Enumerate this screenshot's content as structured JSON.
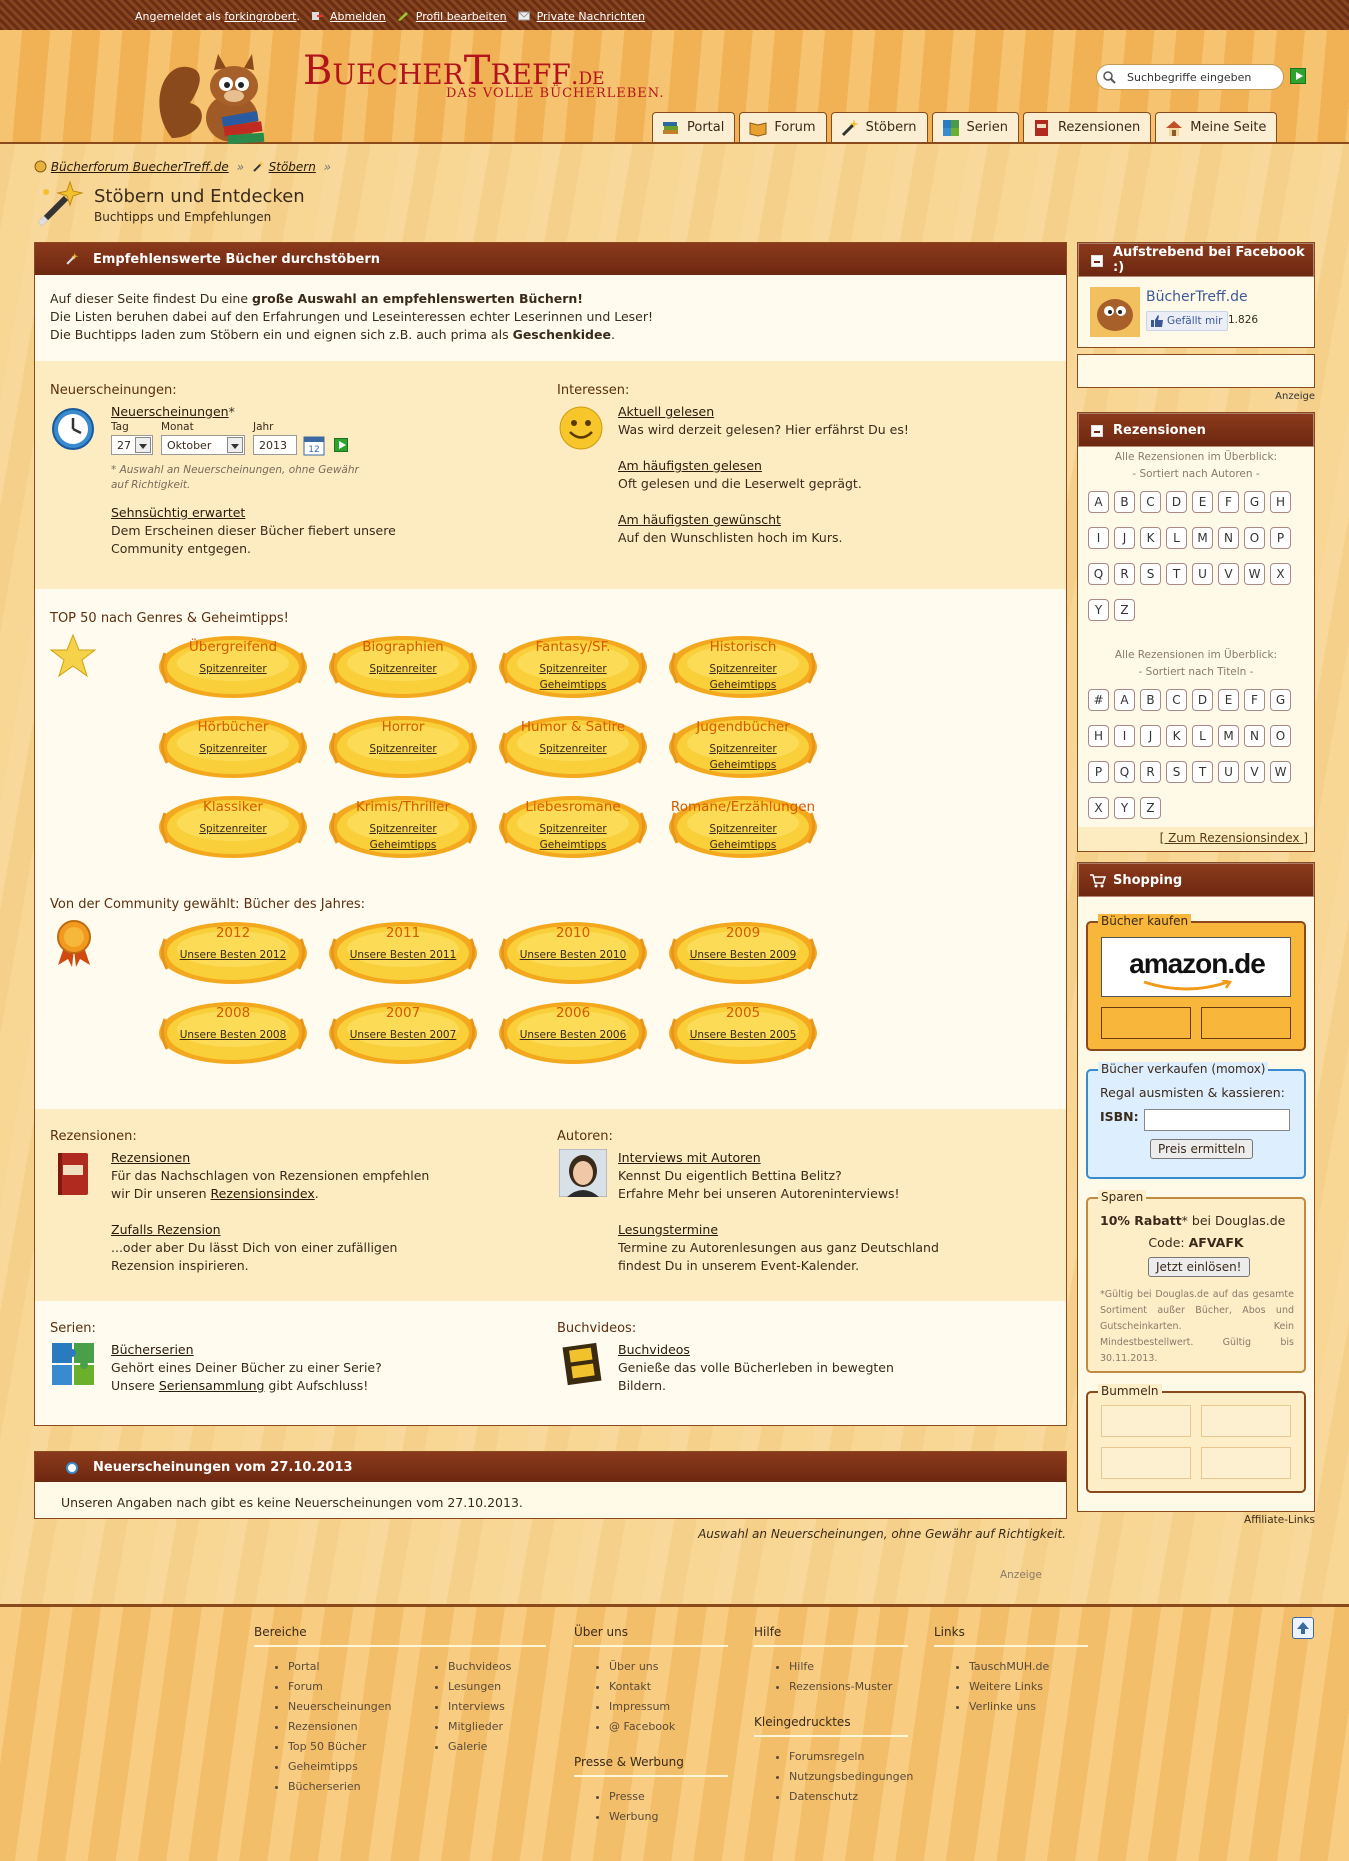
{
  "topbar": {
    "logged_in_prefix": "Angemeldet als",
    "username": "forkingrobert",
    "logout": "Abmelden",
    "edit_profile": "Profil bearbeiten",
    "messages": "Private Nachrichten"
  },
  "logo": {
    "title": "BuecherTreff",
    "tld": ".de",
    "tagline": "DAS VOLLE BÜCHERLEBEN."
  },
  "search": {
    "placeholder": "Suchbegriffe eingeben"
  },
  "nav": [
    "Portal",
    "Forum",
    "Stöbern",
    "Serien",
    "Rezensionen",
    "Meine Seite"
  ],
  "breadcrumb": {
    "home": "Bücherforum BuecherTreff.de",
    "current": "Stöbern",
    "sep": "»"
  },
  "page": {
    "title": "Stöbern und Entdecken",
    "subtitle": "Buchtipps und Empfehlungen"
  },
  "main": {
    "header": "Empfehlenswerte Bücher durchstöbern",
    "intro1_pre": "Auf dieser Seite findest Du eine ",
    "intro1_bold": "große Auswahl an empfehlenswerten Büchern!",
    "intro2": "Die Listen beruhen dabei auf den Erfahrungen und Leseinteressen echter Leserinnen und Leser!",
    "intro3_pre": "Die Buchtipps laden zum Stöbern ein und eignen sich z.B. auch prima als ",
    "intro3_bold": "Geschenkidee",
    "intro3_end": "."
  },
  "new_releases": {
    "heading": "Neuerscheinungen:",
    "link": "Neuerscheinungen",
    "star": "*",
    "day_label": "Tag",
    "month_label": "Monat",
    "year_label": "Jahr",
    "day": "27",
    "month": "Oktober",
    "year": "2013",
    "note": "* Auswahl an Neuerscheinungen, ohne Gewähr auf Richtigkeit.",
    "awaited_link": "Sehnsüchtig erwartet",
    "awaited_text1": "Dem Erscheinen dieser Bücher fiebert unsere",
    "awaited_text2": "Community entgegen."
  },
  "interests": {
    "heading": "Interessen:",
    "items": [
      {
        "link": "Aktuell gelesen",
        "text": "Was wird derzeit gelesen? Hier erfährst Du es!"
      },
      {
        "link": "Am häufigsten gelesen",
        "text": "Oft gelesen und die Leserwelt geprägt."
      },
      {
        "link": "Am häufigsten gewünscht",
        "text": "Auf den Wunschlisten hoch im Kurs."
      }
    ]
  },
  "top50": {
    "heading": "TOP 50 nach Genres & Geheimtipps!",
    "badges": [
      {
        "title": "Übergreifend",
        "l1": "Spitzenreiter",
        "l2": ""
      },
      {
        "title": "Biographien",
        "l1": "Spitzenreiter",
        "l2": ""
      },
      {
        "title": "Fantasy/SF.",
        "l1": "Spitzenreiter",
        "l2": "Geheimtipps"
      },
      {
        "title": "Historisch",
        "l1": "Spitzenreiter",
        "l2": "Geheimtipps"
      },
      {
        "title": "Hörbücher",
        "l1": "Spitzenreiter",
        "l2": ""
      },
      {
        "title": "Horror",
        "l1": "Spitzenreiter",
        "l2": ""
      },
      {
        "title": "Humor & Satire",
        "l1": "Spitzenreiter",
        "l2": ""
      },
      {
        "title": "Jugendbücher",
        "l1": "Spitzenreiter",
        "l2": "Geheimtipps"
      },
      {
        "title": "Klassiker",
        "l1": "Spitzenreiter",
        "l2": ""
      },
      {
        "title": "Krimis/Thriller",
        "l1": "Spitzenreiter",
        "l2": "Geheimtipps"
      },
      {
        "title": "Liebesromane",
        "l1": "Spitzenreiter",
        "l2": "Geheimtipps"
      },
      {
        "title": "Romane/Erzählungen",
        "l1": "Spitzenreiter",
        "l2": "Geheimtipps"
      }
    ]
  },
  "years": {
    "heading": "Von der Community gewählt: Bücher des Jahres:",
    "badges": [
      {
        "title": "2012",
        "l1": "Unsere Besten 2012"
      },
      {
        "title": "2011",
        "l1": "Unsere Besten 2011"
      },
      {
        "title": "2010",
        "l1": "Unsere Besten 2010"
      },
      {
        "title": "2009",
        "l1": "Unsere Besten 2009"
      },
      {
        "title": "2008",
        "l1": "Unsere Besten 2008"
      },
      {
        "title": "2007",
        "l1": "Unsere Besten 2007"
      },
      {
        "title": "2006",
        "l1": "Unsere Besten 2006"
      },
      {
        "title": "2005",
        "l1": "Unsere Besten 2005"
      }
    ]
  },
  "reviews": {
    "heading": "Rezensionen:",
    "link": "Rezensionen",
    "text1": "Für das Nachschlagen von Rezensionen empfehlen",
    "text2_pre": "wir Dir unseren ",
    "text2_link": "Rezensionsindex",
    "text2_end": ".",
    "random_link": "Zufalls Rezension",
    "random_text1": "...oder aber Du lässt Dich von einer zufälligen",
    "random_text2": "Rezension inspirieren."
  },
  "authors": {
    "heading": "Autoren:",
    "link": "Interviews mit Autoren",
    "text1": "Kennst Du eigentlich Bettina Belitz?",
    "text2": "Erfahre Mehr bei unseren Autoreninterviews!",
    "readings_link": "Lesungstermine",
    "readings_text1": "Termine zu Autorenlesungen aus ganz Deutschland",
    "readings_text2": "findest Du in unserem Event-Kalender."
  },
  "series": {
    "heading": "Serien:",
    "link": "Bücherserien",
    "text1": "Gehört eines Deiner Bücher zu einer Serie?",
    "text2_pre": "Unsere ",
    "text2_link": "Seriensammlung",
    "text2_end": " gibt Aufschluss!"
  },
  "videos": {
    "heading": "Buchvideos:",
    "link": "Buchvideos",
    "text1": "Genieße das volle Bücherleben in bewegten",
    "text2": "Bildern."
  },
  "new_box": {
    "header": "Neuerscheinungen vom 27.10.2013",
    "text": "Unseren Angaben nach gibt es keine Neuerscheinungen vom 27.10.2013.",
    "note": "Auswahl an Neuerscheinungen, ohne Gewähr auf Richtigkeit.",
    "ad": "Anzeige"
  },
  "sidebar": {
    "facebook": {
      "header": "Aufstrebend bei Facebook :)",
      "name": "BücherTreff.de",
      "like": "Gefällt mir",
      "count": "1.826"
    },
    "ad_label": "Anzeige",
    "reviews": {
      "header": "Rezensionen",
      "by_author_1": "Alle Rezensionen im Überblick:",
      "by_author_2": "- Sortiert nach Autoren -",
      "author_letters": [
        "A",
        "B",
        "C",
        "D",
        "E",
        "F",
        "G",
        "H",
        "I",
        "J",
        "K",
        "L",
        "M",
        "N",
        "O",
        "P",
        "Q",
        "R",
        "S",
        "T",
        "U",
        "V",
        "W",
        "X",
        "Y",
        "Z"
      ],
      "by_title_1": "Alle Rezensionen im Überblick:",
      "by_title_2": "- Sortiert nach Titeln -",
      "title_letters": [
        "#",
        "A",
        "B",
        "C",
        "D",
        "E",
        "F",
        "G",
        "H",
        "I",
        "J",
        "K",
        "L",
        "M",
        "N",
        "O",
        "P",
        "Q",
        "R",
        "S",
        "T",
        "U",
        "V",
        "W",
        "X",
        "Y",
        "Z"
      ],
      "index_link": "[ Zum Rezensionsindex ]"
    },
    "shopping": {
      "header": "Shopping",
      "buy_legend": "Bücher kaufen",
      "amazon": "amazon.de",
      "sell_legend": "Bücher verkaufen (momox)",
      "sell_text": "Regal ausmisten & kassieren:",
      "isbn_label": "ISBN:",
      "price_button": "Preis ermitteln",
      "save_legend": "Sparen",
      "discount_bold": "10% Rabatt",
      "discount_rest": "* bei Douglas.de",
      "code_label": "Code:",
      "code": "AFVAFK",
      "redeem_button": "Jetzt einlösen!",
      "fine_print": "*Gültig bei Douglas.de auf das gesamte Sortiment außer Bücher, Abos und Gutscheinkarten. Kein Mindestbestellwert. Gültig bis 30.11.2013.",
      "browse_legend": "Bummeln",
      "affiliate": "Affiliate-Links"
    }
  },
  "footer": {
    "bereiche": {
      "heading": "Bereiche",
      "col1": [
        "Portal",
        "Forum",
        "Neuerscheinungen",
        "Rezensionen",
        "Top 50 Bücher",
        "Geheimtipps",
        "Bücherserien"
      ],
      "col2": [
        "Buchvideos",
        "Lesungen",
        "Interviews",
        "Mitglieder",
        "Galerie"
      ]
    },
    "about": {
      "heading": "Über uns",
      "items": [
        "Über uns",
        "Kontakt",
        "Impressum",
        "@ Facebook"
      ]
    },
    "press": {
      "heading": "Presse & Werbung",
      "items": [
        "Presse",
        "Werbung"
      ]
    },
    "help": {
      "heading": "Hilfe",
      "items": [
        "Hilfe",
        "Rezensions-Muster"
      ]
    },
    "fine": {
      "heading": "Kleingedrucktes",
      "items": [
        "Forumsregeln",
        "Nutzungsbedingungen",
        "Datenschutz"
      ]
    },
    "links": {
      "heading": "Links",
      "items": [
        "TauschMUH.de",
        "Weitere Links",
        "Verlinke uns"
      ]
    }
  }
}
